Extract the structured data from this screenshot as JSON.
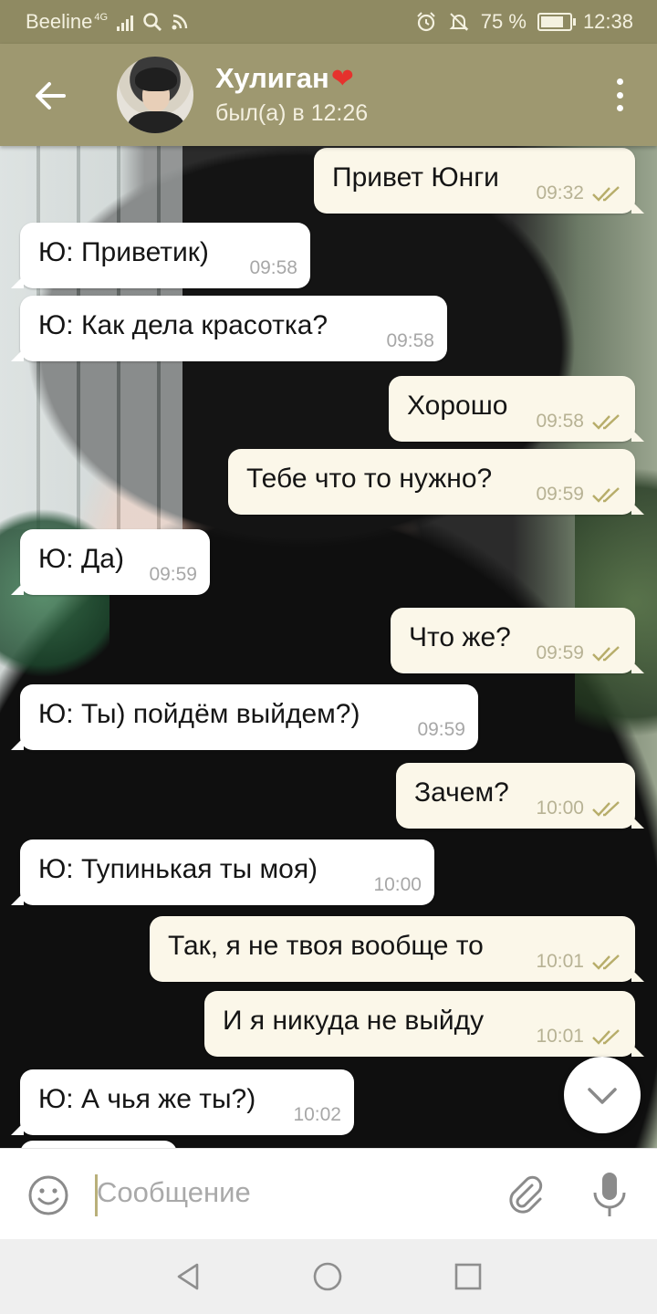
{
  "status_bar": {
    "carrier": "Beeline",
    "network": "4G",
    "battery": "75 %",
    "time": "12:38",
    "icons": [
      "signal-icon",
      "search-icon",
      "rss-icon",
      "alarm-icon",
      "mute-icon",
      "battery-icon"
    ]
  },
  "header": {
    "contact_name": "Хулиган",
    "heart": "❤",
    "last_seen": "был(а) в 12:26"
  },
  "messages": [
    {
      "dir": "out",
      "text": "Привет Юнги",
      "time": "09:32"
    },
    {
      "dir": "in",
      "text": "Ю: Приветик)",
      "time": "09:58"
    },
    {
      "dir": "in",
      "text": "Ю: Как дела красотка?",
      "time": "09:58"
    },
    {
      "dir": "out",
      "text": "Хорошо",
      "time": "09:58"
    },
    {
      "dir": "out",
      "text": "Тебе что то нужно?",
      "time": "09:59"
    },
    {
      "dir": "in",
      "text": "Ю: Да)",
      "time": "09:59"
    },
    {
      "dir": "out",
      "text": "Что же?",
      "time": "09:59"
    },
    {
      "dir": "in",
      "text": "Ю: Ты) пойдём выйдем?)",
      "time": "09:59"
    },
    {
      "dir": "out",
      "text": "Зачем?",
      "time": "10:00"
    },
    {
      "dir": "in",
      "text": "Ю: Тупинькая ты моя)",
      "time": "10:00"
    },
    {
      "dir": "out",
      "text": "Так, я не твоя вообще то",
      "time": "10:01"
    },
    {
      "dir": "out",
      "text": "И я никуда не выйду",
      "time": "10:01"
    },
    {
      "dir": "in",
      "text": "Ю: А чья же ты?)",
      "time": "10:02"
    }
  ],
  "composer": {
    "placeholder": "Сообщение"
  },
  "colors": {
    "header": "#9e9870",
    "status_bar": "#8f8a62",
    "outgoing_bubble": "#fbf7e9",
    "incoming_bubble": "#ffffff",
    "read_ticks": "#b7ad6a"
  }
}
